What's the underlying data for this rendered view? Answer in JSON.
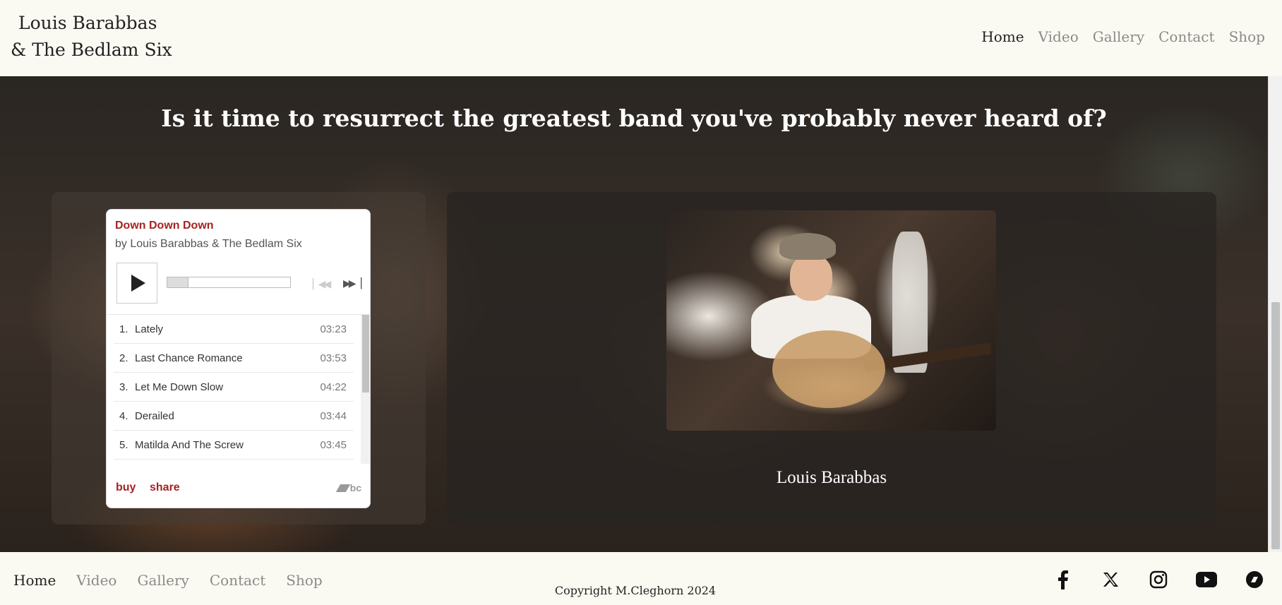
{
  "header": {
    "brand_line1": "Louis Barabbas",
    "brand_line2": "& The Bedlam Six",
    "nav": [
      "Home",
      "Video",
      "Gallery",
      "Contact",
      "Shop"
    ]
  },
  "hero": {
    "headline": "Is it time to resurrect the greatest band you've probably never heard of?"
  },
  "player": {
    "title": "Down Down Down",
    "by": "by Louis Barabbas & The Bedlam Six",
    "progress": 0.17,
    "tracks": [
      {
        "num": "1.",
        "name": "Lately",
        "dur": "03:23"
      },
      {
        "num": "2.",
        "name": "Last Chance Romance",
        "dur": "03:53"
      },
      {
        "num": "3.",
        "name": "Let Me Down Slow",
        "dur": "04:22"
      },
      {
        "num": "4.",
        "name": "Derailed",
        "dur": "03:44"
      },
      {
        "num": "5.",
        "name": "Matilda And The Screw",
        "dur": "03:45"
      }
    ],
    "buy": "buy",
    "share": "share",
    "logo_text": "bc",
    "icons": {
      "play": "play-icon",
      "prev": "previous-track-icon",
      "next": "next-track-icon"
    }
  },
  "feature": {
    "caption": "Louis Barabbas"
  },
  "footer": {
    "nav": [
      "Home",
      "Video",
      "Gallery",
      "Contact",
      "Shop"
    ],
    "copyright": "Copyright M.Cleghorn 2024",
    "social": [
      "facebook-icon",
      "x-icon",
      "instagram-icon",
      "youtube-icon",
      "bandcamp-icon"
    ]
  },
  "colors": {
    "accent": "#a52323",
    "background": "#fbfaf2",
    "nav_inactive": "#8a8a8a"
  }
}
